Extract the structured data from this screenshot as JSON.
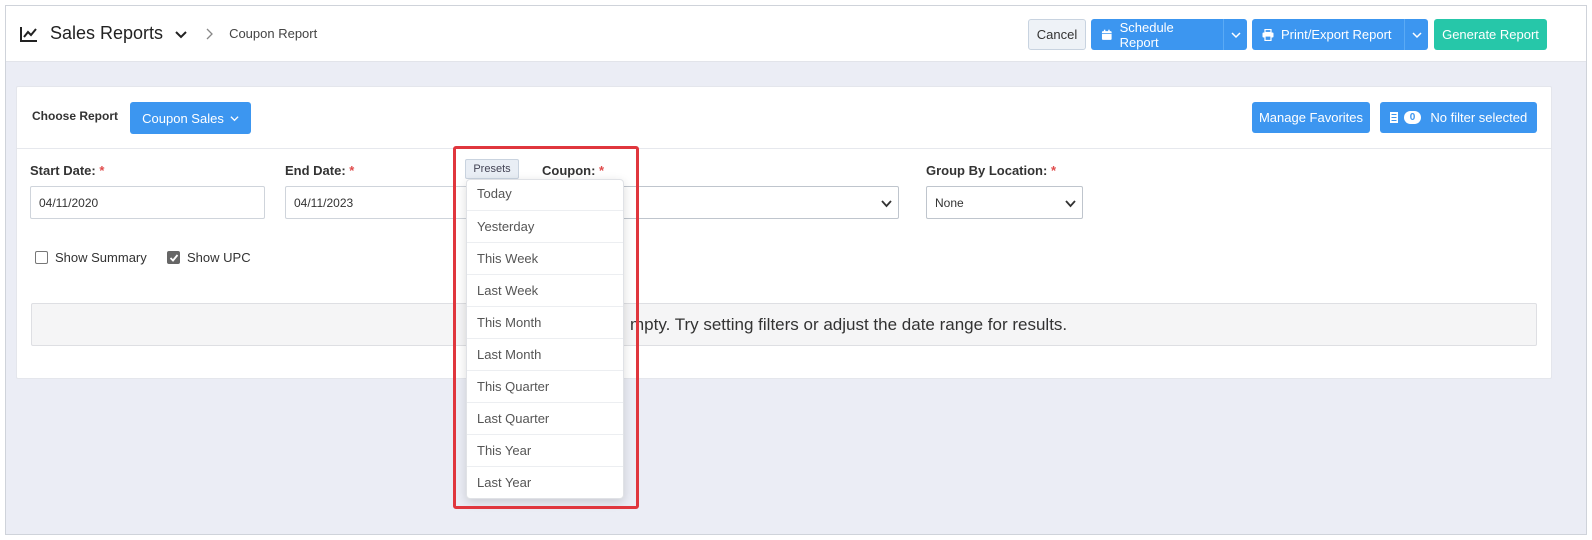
{
  "header": {
    "title": "Sales Reports",
    "breadcrumb": "Coupon Report",
    "buttons": {
      "cancel": "Cancel",
      "schedule": "Schedule Report",
      "print_export": "Print/Export Report",
      "generate": "Generate Report"
    }
  },
  "report_bar": {
    "choose_label": "Choose Report",
    "selected_report": "Coupon Sales",
    "manage_favorites": "Manage Favorites",
    "filter_count": "0",
    "filter_status": "No filter selected"
  },
  "filters": {
    "start_date": {
      "label": "Start Date:",
      "required": "*",
      "value": "04/11/2020"
    },
    "end_date": {
      "label": "End Date:",
      "required": "*",
      "value": "04/11/2023"
    },
    "presets_label": "Presets",
    "coupon": {
      "label": "Coupon:",
      "required": "*",
      "value": ""
    },
    "group_by_location": {
      "label": "Group By Location:",
      "required": "*",
      "value": "None"
    }
  },
  "options": {
    "show_summary": {
      "label": "Show Summary",
      "checked": false
    },
    "show_upc": {
      "label": "Show UPC",
      "checked": true
    }
  },
  "empty_message_visible": "mpty. Try setting filters or adjust the date range for results.",
  "presets_dropdown": {
    "items": [
      "Today",
      "Yesterday",
      "This Week",
      "Last Week",
      "This Month",
      "Last Month",
      "This Quarter",
      "Last Quarter",
      "This Year",
      "Last Year"
    ]
  },
  "colors": {
    "primary": "#3c96f0",
    "success": "#26c7a9",
    "required": "#e04b4b",
    "highlight": "#e0363d"
  }
}
